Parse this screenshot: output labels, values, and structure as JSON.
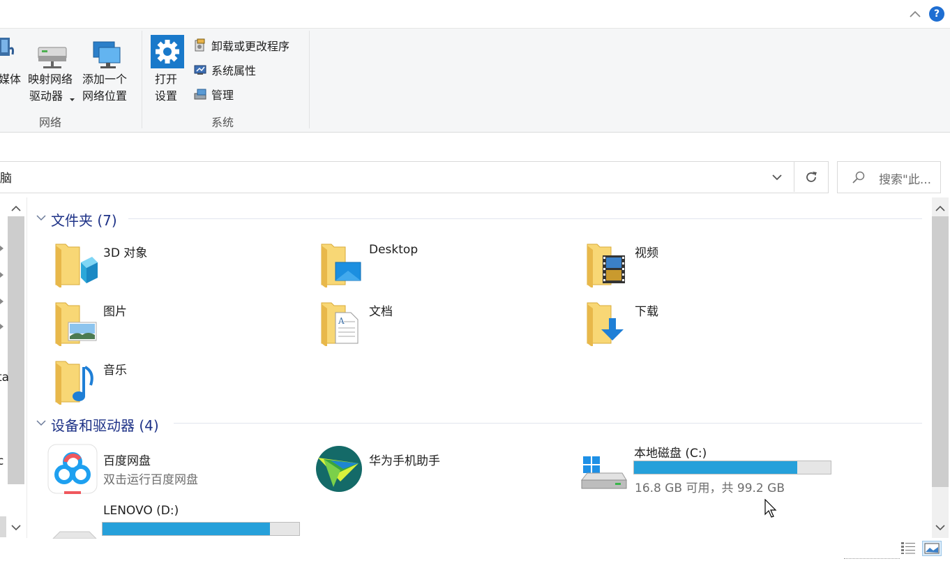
{
  "ribbon": {
    "network_group_label": "网络",
    "system_group_label": "系统",
    "media_label_partial": "媒体",
    "map_drive_line1": "映射网络",
    "map_drive_line2": "驱动器",
    "add_location_line1": "添加一个",
    "add_location_line2": "网络位置",
    "open_settings_line1": "打开",
    "open_settings_line2": "设置",
    "uninstall_label": "卸载或更改程序",
    "system_props_label": "系统属性",
    "manage_label": "管理"
  },
  "help_label": "?",
  "address": {
    "path_partial": "脑"
  },
  "search": {
    "placeholder": "搜索\"此..."
  },
  "nav": {
    "partial_ta": "ta",
    "partial_c": "c"
  },
  "folders": {
    "header": "文件夹 (7)",
    "items": [
      {
        "name": "3D 对象",
        "icon": "3d-objects-folder-icon"
      },
      {
        "name": "Desktop",
        "icon": "desktop-folder-icon"
      },
      {
        "name": "视频",
        "icon": "videos-folder-icon"
      },
      {
        "name": "图片",
        "icon": "pictures-folder-icon"
      },
      {
        "name": "文档",
        "icon": "documents-folder-icon"
      },
      {
        "name": "下载",
        "icon": "downloads-folder-icon"
      },
      {
        "name": "音乐",
        "icon": "music-folder-icon"
      }
    ]
  },
  "devices": {
    "header": "设备和驱动器 (4)",
    "baidu": {
      "name": "百度网盘",
      "sub": "双击运行百度网盘"
    },
    "huawei": {
      "name": "华为手机助手"
    },
    "c_drive": {
      "name": "本地磁盘 (C:)",
      "sub": "16.8 GB 可用，共 99.2 GB",
      "used_fraction": 0.83
    },
    "d_drive": {
      "name": "LENOVO (D:)",
      "used_fraction": 0.85
    }
  },
  "colors": {
    "accent": "#26a0da",
    "header": "#1e3287",
    "folder": "#f8d775"
  }
}
